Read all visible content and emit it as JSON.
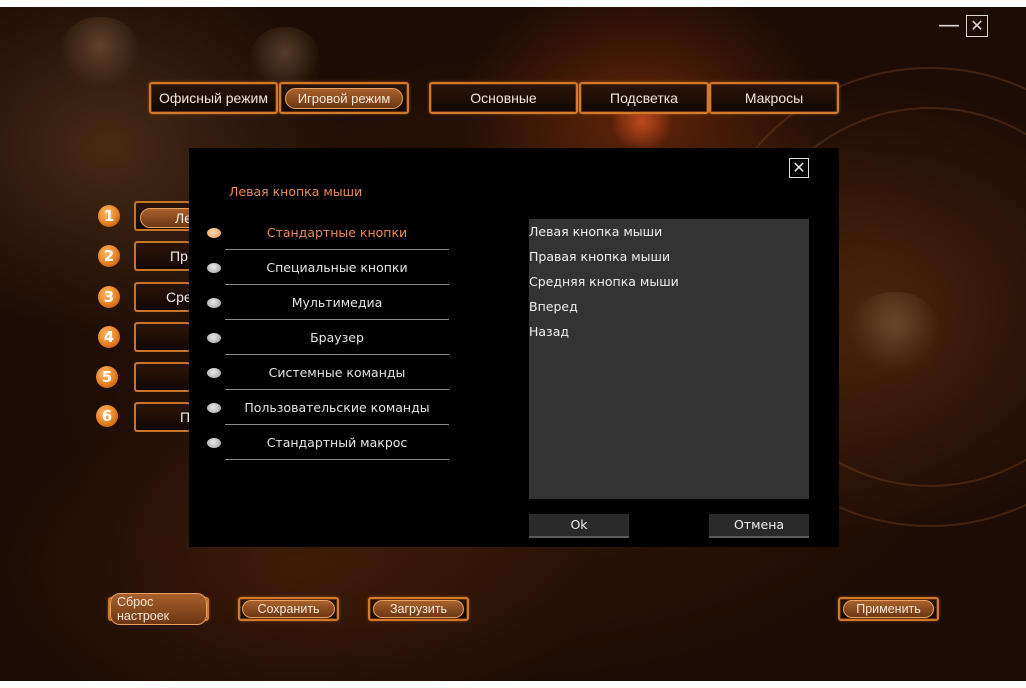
{
  "window": {
    "minimize_glyph": "—",
    "close_glyph": "✕"
  },
  "mode_tabs": [
    {
      "label": "Офисный режим",
      "active": false
    },
    {
      "label": "Игровой режим",
      "active": true
    }
  ],
  "section_tabs": [
    {
      "label": "Основные"
    },
    {
      "label": "Подсветка"
    },
    {
      "label": "Макросы"
    }
  ],
  "button_slots": [
    {
      "number": "1",
      "label": "Лев"
    },
    {
      "number": "2",
      "label": "Пр"
    },
    {
      "number": "3",
      "label": "Сре"
    },
    {
      "number": "4",
      "label": ""
    },
    {
      "number": "5",
      "label": ""
    },
    {
      "number": "6",
      "label": "П"
    }
  ],
  "footer": {
    "reset_label": "Сброс настроек",
    "save_label": "Сохранить",
    "load_label": "Загрузить",
    "apply_label": "Применить"
  },
  "modal": {
    "title": "Левая кнопка мыши",
    "close_glyph": "✕",
    "categories": [
      {
        "label": "Стандартные кнопки",
        "active": true
      },
      {
        "label": "Специальные кнопки",
        "active": false
      },
      {
        "label": "Мультимедиа",
        "active": false
      },
      {
        "label": "Браузер",
        "active": false
      },
      {
        "label": "Системные команды",
        "active": false
      },
      {
        "label": "Пользовательские команды",
        "active": false
      },
      {
        "label": "Стандартный макрос",
        "active": false
      }
    ],
    "options": [
      "Левая кнопка мыши",
      "Правая кнопка мыши",
      "Средняя кнопка мыши",
      "Вперед",
      "Назад"
    ],
    "ok_label": "Ok",
    "cancel_label": "Отмена"
  },
  "colors": {
    "accent": "#d27a2a",
    "active_text": "#ec8a5c",
    "modal_bg": "#000000",
    "list_bg": "#333333"
  }
}
